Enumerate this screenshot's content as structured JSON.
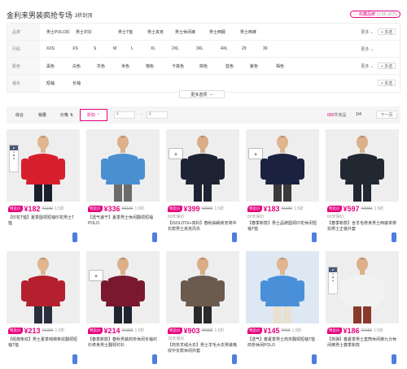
{
  "header": {
    "title": "金利来男装疯抢专场",
    "subtitle": "3折封顶",
    "favorite_label": "收藏品牌",
    "favorite_count": "(1,56,10万)"
  },
  "filters": [
    {
      "label": "品类",
      "options": [
        "男士POLO衫",
        "男士衬衫",
        "男士T恤",
        "男士夹克",
        "男士休闲裤",
        "男士西服",
        "男士西裤"
      ],
      "more": "更多",
      "multi": "+ 多选"
    },
    {
      "label": "尺码",
      "options": [
        "XXS",
        "XS",
        "S",
        "M",
        "L",
        "XL",
        "2XL",
        "3XL",
        "4XL",
        "29",
        "30"
      ],
      "more": "更多",
      "multi": ""
    },
    {
      "label": "颜色",
      "options": [
        "黑色",
        "白色",
        "灰色",
        "米色",
        "咖色",
        "卡其色",
        "棕色",
        "蓝色",
        "紫色",
        "褐色"
      ],
      "more": "更多",
      "multi": "+ 多选"
    },
    {
      "label": "袖长",
      "options": [
        "短袖",
        "长袖"
      ],
      "more": "",
      "multi": "+ 多选"
    }
  ],
  "more_options": "更多选项",
  "sortbar": {
    "items": [
      "综合",
      "销量",
      "价格"
    ],
    "discount": "折扣",
    "price_from": "¥",
    "price_to": "¥",
    "dash": "-",
    "count_num": "685",
    "count_label": "件商品",
    "page": "1/4",
    "next": "下一页"
  },
  "products": [
    {
      "special": "特卖价",
      "price": "¥182",
      "orig": "¥1190",
      "disc": "1.5折",
      "days": "",
      "name": "【印花T恤】夏季圆领短袖印花男士T恤",
      "badge": "tag",
      "shirt": "#d81f2e",
      "pants": "#1a1f2e",
      "bg": "#eeeeee",
      "skin": "#e0b58f"
    },
    {
      "special": "特卖价",
      "price": "¥336",
      "orig": "¥2190",
      "disc": "1.5折",
      "days": "",
      "name": "【透气速干】夏季男士休闲翻领短袖POLO",
      "badge": "",
      "shirt": "#4a8fd0",
      "pants": "#6b6b6b",
      "bg": "#eeeeee",
      "skin": "#dcb08a"
    },
    {
      "special": "特卖价",
      "price": "¥399",
      "orig": "¥2590",
      "disc": "1.5折",
      "days": "60天保价",
      "name": "【ISOLOTE+高科】春秋抽绳商务简中长款男士夹克风衣",
      "badge": "gift",
      "shirt": "#1d2333",
      "pants": "#1d2333",
      "bg": "#eeeeee",
      "skin": "#d9ad86"
    },
    {
      "special": "特卖价",
      "price": "¥183",
      "orig": "¥1190",
      "disc": "1.5折",
      "days": "60天保价",
      "name": "【春季新款】男士品牌圆领印花休闲短袖T恤",
      "badge": "gift",
      "shirt": "#1a2240",
      "pants": "#3a3a3a",
      "bg": "#eeeeee",
      "skin": "#e0b58f"
    },
    {
      "special": "特卖价",
      "price": "¥597",
      "orig": "¥3990",
      "disc": "1.5折",
      "days": "60天保价",
      "name": "【春季新款】含羊毛修身男士西装单排扣男士正装外套",
      "badge": "",
      "shirt": "#222831",
      "pants": "#222831",
      "bg": "#eeeeee",
      "skin": "#dcb08a"
    },
    {
      "special": "特卖价",
      "price": "¥213",
      "orig": "¥1390",
      "disc": "1.5折",
      "days": "",
      "name": "【经典条纹】男士夏季纯棉条纹翻领短袖T恤",
      "badge": "",
      "shirt": "#b5202f",
      "pants": "#2a2f3e",
      "bg": "#eeeeee",
      "skin": "#e0b58f"
    },
    {
      "special": "特卖价",
      "price": "¥214",
      "orig": "¥1390",
      "disc": "1.5折",
      "days": "",
      "name": "【春季新款】春秋男装商务休闲长袖衬衫修身男士翻领衬衫",
      "badge": "gift",
      "shirt": "#7a1830",
      "pants": "#1f2430",
      "bg": "#eeeeee",
      "skin": "#dcb08a"
    },
    {
      "special": "特卖价",
      "price": "¥903",
      "orig": "¥5990",
      "disc": "1.5折",
      "days": "30天保价",
      "name": "【商务羊绒大衣】男士羊毛大衣男装格纹中长款休闲外套",
      "badge": "",
      "shirt": "#6b5a4e",
      "pants": "#2a2a2a",
      "bg": "#eeeeee",
      "skin": "#d9ad86"
    },
    {
      "special": "特卖价",
      "price": "¥145",
      "orig": "¥990",
      "disc": "1.5折",
      "days": "",
      "name": "【透气】春夏季男士商务翻领短袖T恤商务休闲POLO",
      "badge": "",
      "shirt": "#4a90d9",
      "pants": "#e8e0d0",
      "bg": "#dde8f2",
      "skin": "#e0b58f"
    },
    {
      "special": "特卖价",
      "price": "¥186",
      "orig": "¥1190",
      "disc": "1.5折",
      "days": "",
      "name": "【高弹】春夏季男士直筒休闲裤九分休闲裤男士春季新款",
      "badge": "tag",
      "shirt": "#f2f2f2",
      "pants": "#8a3a2a",
      "bg": "#eeeeee",
      "skin": "#dcb08a"
    }
  ]
}
